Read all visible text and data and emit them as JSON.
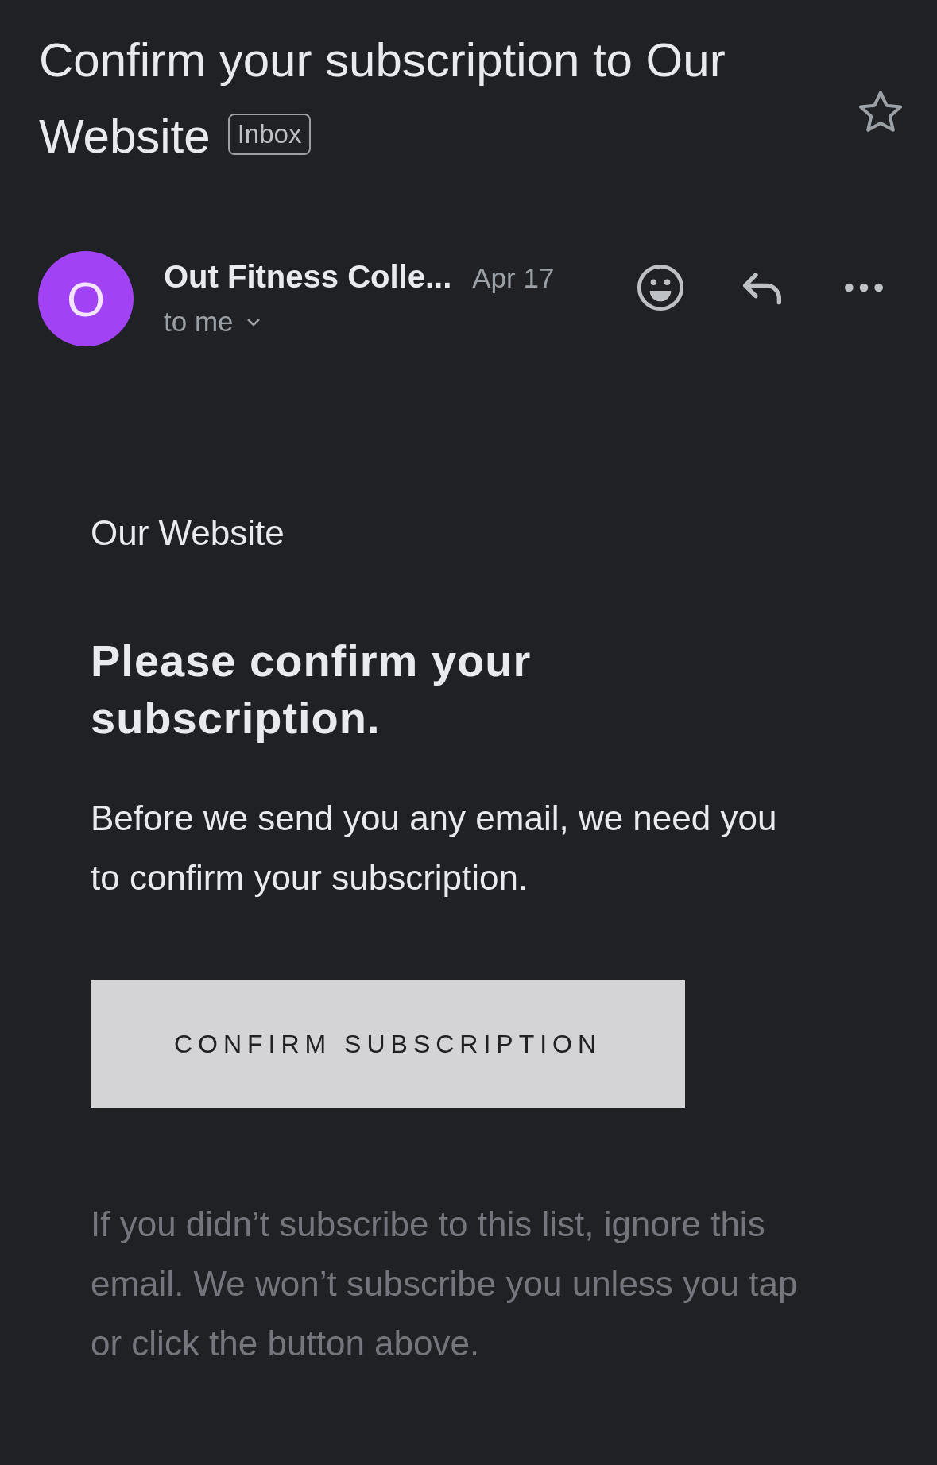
{
  "subject": {
    "title": "Confirm your subscription to Our Website",
    "label": "Inbox",
    "starred": false
  },
  "message": {
    "sender": "Out Fitness Colle...",
    "avatar_letter": "O",
    "color": "#a142f4",
    "date": "Apr 17",
    "recipient": "to me"
  },
  "body": {
    "brand": "Our Website",
    "heading": "Please confirm your subscription.",
    "text": "Before we send you any email, we need you to confirm your subscription.",
    "button": "CONFIRM SUBSCRIPTION",
    "footer": "If you didn’t subscribe to this list, ignore this email. We won’t subscribe you unless you tap or click the button above."
  }
}
